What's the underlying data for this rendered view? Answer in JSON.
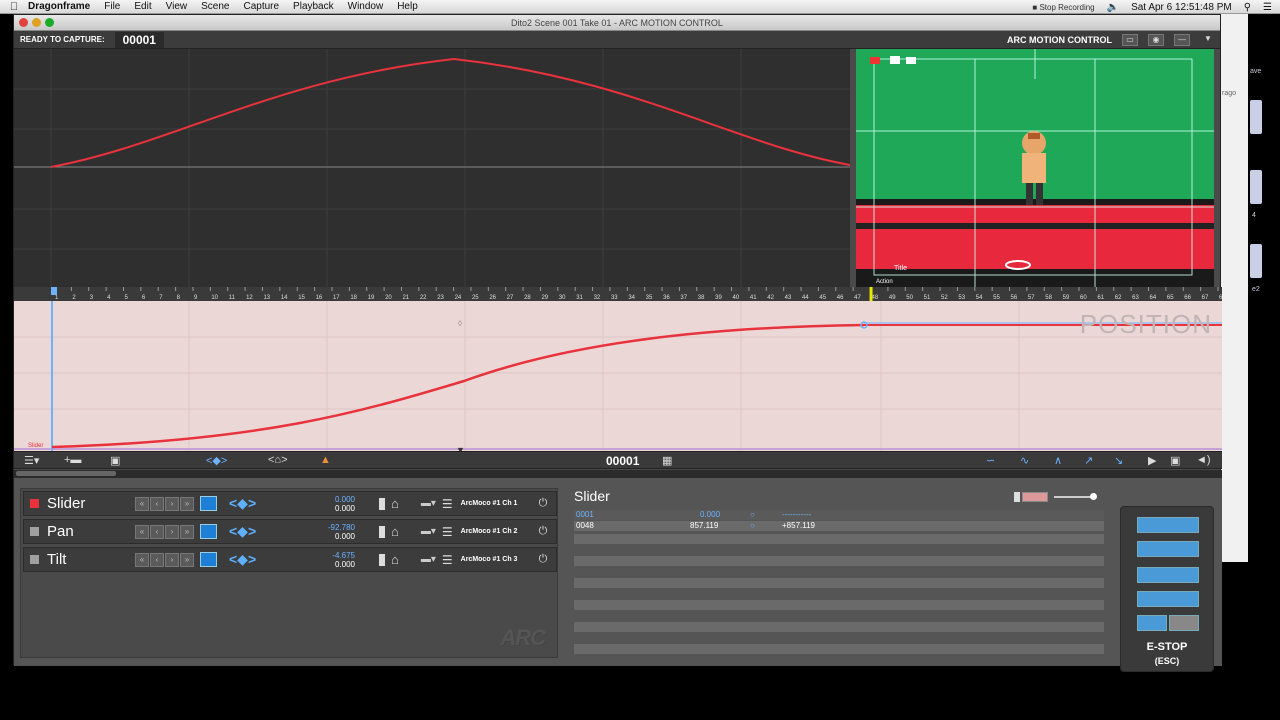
{
  "menubar": {
    "app_name": "Dragonframe",
    "items": [
      "File",
      "Edit",
      "View",
      "Scene",
      "Capture",
      "Playback",
      "Window",
      "Help"
    ],
    "stop_recording": "Stop Recording",
    "clock": "Sat Apr 6  12:51:48 PM"
  },
  "desktop": {
    "labels": [
      "ave",
      "rago",
      "4",
      "e2"
    ]
  },
  "window": {
    "title": "Dito2  Scene 001  Take 01 - ARC MOTION CONTROL"
  },
  "toolbar": {
    "ready_label": "READY TO CAPTURE:",
    "frame": "00001",
    "panel_title": "ARC MOTION CONTROL"
  },
  "video": {
    "title_label": "Title",
    "action_label": "Action"
  },
  "timeline": {
    "start": 1,
    "end": 68,
    "playhead": 1,
    "marker": 48
  },
  "position_graph": {
    "label": "POSITION",
    "axis_label": "Slider"
  },
  "control_bar": {
    "frame": "00001"
  },
  "axes": [
    {
      "name": "Slider",
      "value_top": "0.000",
      "value_bottom": "0.000",
      "channel": "ArcMoco #1 Ch 1",
      "color": "#e8323c"
    },
    {
      "name": "Pan",
      "value_top": "-92.780",
      "value_bottom": "0.000",
      "channel": "ArcMoco #1 Ch 2",
      "color": "#a0a0a0"
    },
    {
      "name": "Tilt",
      "value_top": "-4.675",
      "value_bottom": "0.000",
      "channel": "ArcMoco #1 Ch 3",
      "color": "#a0a0a0"
    }
  ],
  "arc_logo": "ARC",
  "keyframes": {
    "title": "Slider",
    "rows": [
      {
        "frame": "0001",
        "value": "0.000",
        "delta": "-----------"
      },
      {
        "frame": "0048",
        "value": "857.119",
        "delta": "+857.119"
      }
    ]
  },
  "estop": {
    "label": "E-STOP",
    "sublabel": "(ESC)"
  },
  "colors": {
    "curve": "#e8323c",
    "accent": "#5fb0ff",
    "green_screen": "#23a356"
  }
}
